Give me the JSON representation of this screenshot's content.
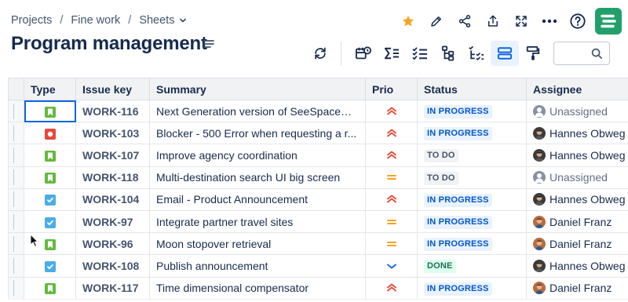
{
  "breadcrumb": {
    "projects": "Projects",
    "sep1": "/",
    "space": "Fine work",
    "sep2": "/",
    "current": "Sheets"
  },
  "page_title": "Program management",
  "colors": {
    "accent": "#0c66e4",
    "star": "#f5a524",
    "logo": "#22a06b",
    "story": "#63ba3c",
    "bug": "#e5493a",
    "task": "#4bade8"
  },
  "top_actions": [
    "star-icon",
    "edit-icon",
    "share-icon",
    "export-icon",
    "fullscreen-icon",
    "more-icon",
    "help-icon",
    "app-logo"
  ],
  "toolbar": [
    "refresh-icon",
    "calendar-timeline-icon",
    "sum-icon",
    "checklist-icon",
    "hierarchy-icon",
    "subtasks-icon",
    "row-height-icon",
    "format-painter-icon",
    "search-icon"
  ],
  "search": {
    "placeholder": ""
  },
  "table": {
    "headers": {
      "type": "Type",
      "key": "Issue key",
      "summary": "Summary",
      "prio": "Prio",
      "status": "Status",
      "assignee": "Assignee"
    },
    "rows": [
      {
        "type": "story",
        "key": "WORK-116",
        "summary": "Next Generation version of SeeSpaceEZ ...",
        "prio": "highest",
        "status": "IN PROGRESS",
        "status_kind": "inprogress",
        "assignee": "Unassigned",
        "avatar": "unassigned"
      },
      {
        "type": "bug",
        "key": "WORK-103",
        "summary": "Blocker - 500 Error when requesting a r...",
        "prio": "highest",
        "status": "IN PROGRESS",
        "status_kind": "inprogress",
        "assignee": "Hannes Obweg",
        "avatar": "hannes"
      },
      {
        "type": "story",
        "key": "WORK-107",
        "summary": "Improve agency coordination",
        "prio": "highest",
        "status": "TO DO",
        "status_kind": "todo",
        "assignee": "Hannes Obweg",
        "avatar": "hannes"
      },
      {
        "type": "story",
        "key": "WORK-118",
        "summary": "Multi-destination search UI big screen",
        "prio": "medium",
        "status": "TO DO",
        "status_kind": "todo",
        "assignee": "Unassigned",
        "avatar": "unassigned"
      },
      {
        "type": "task",
        "key": "WORK-104",
        "summary": "Email - Product Announcement",
        "prio": "highest",
        "status": "IN PROGRESS",
        "status_kind": "inprogress",
        "assignee": "Hannes Obweg",
        "avatar": "hannes"
      },
      {
        "type": "task",
        "key": "WORK-97",
        "summary": "Integrate partner travel sites",
        "prio": "medium",
        "status": "IN PROGRESS",
        "status_kind": "inprogress",
        "assignee": "Daniel Franz",
        "avatar": "daniel"
      },
      {
        "type": "story",
        "key": "WORK-96",
        "summary": "Moon stopover retrieval",
        "prio": "medium",
        "status": "IN PROGRESS",
        "status_kind": "inprogress",
        "assignee": "Daniel Franz",
        "avatar": "daniel"
      },
      {
        "type": "task",
        "key": "WORK-108",
        "summary": "Publish announcement",
        "prio": "low",
        "status": "DONE",
        "status_kind": "done",
        "assignee": "Hannes Obweg",
        "avatar": "hannes"
      },
      {
        "type": "story",
        "key": "WORK-117",
        "summary": "Time dimensional compensator",
        "prio": "highest",
        "status": "IN PROGRESS",
        "status_kind": "inprogress",
        "assignee": "Daniel Franz",
        "avatar": "daniel"
      }
    ]
  }
}
